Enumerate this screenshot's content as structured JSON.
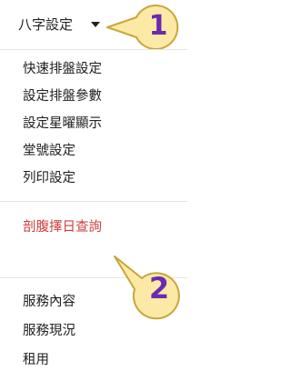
{
  "header": {
    "title": "八字設定"
  },
  "menu": {
    "group1": [
      "快速排盤設定",
      "設定排盤參數",
      "設定星曜顯示",
      "堂號設定",
      "列印設定"
    ],
    "group2": [
      "剖腹擇日查詢"
    ],
    "group3": [
      "服務內容",
      "服務現況",
      "租用"
    ]
  },
  "callouts": [
    "1",
    "2"
  ],
  "colors": {
    "highlight": "#d13b3b",
    "callout_fill": "#fde9a6",
    "callout_stroke": "#c9a63a",
    "callout_text": "#6a2bb0"
  }
}
